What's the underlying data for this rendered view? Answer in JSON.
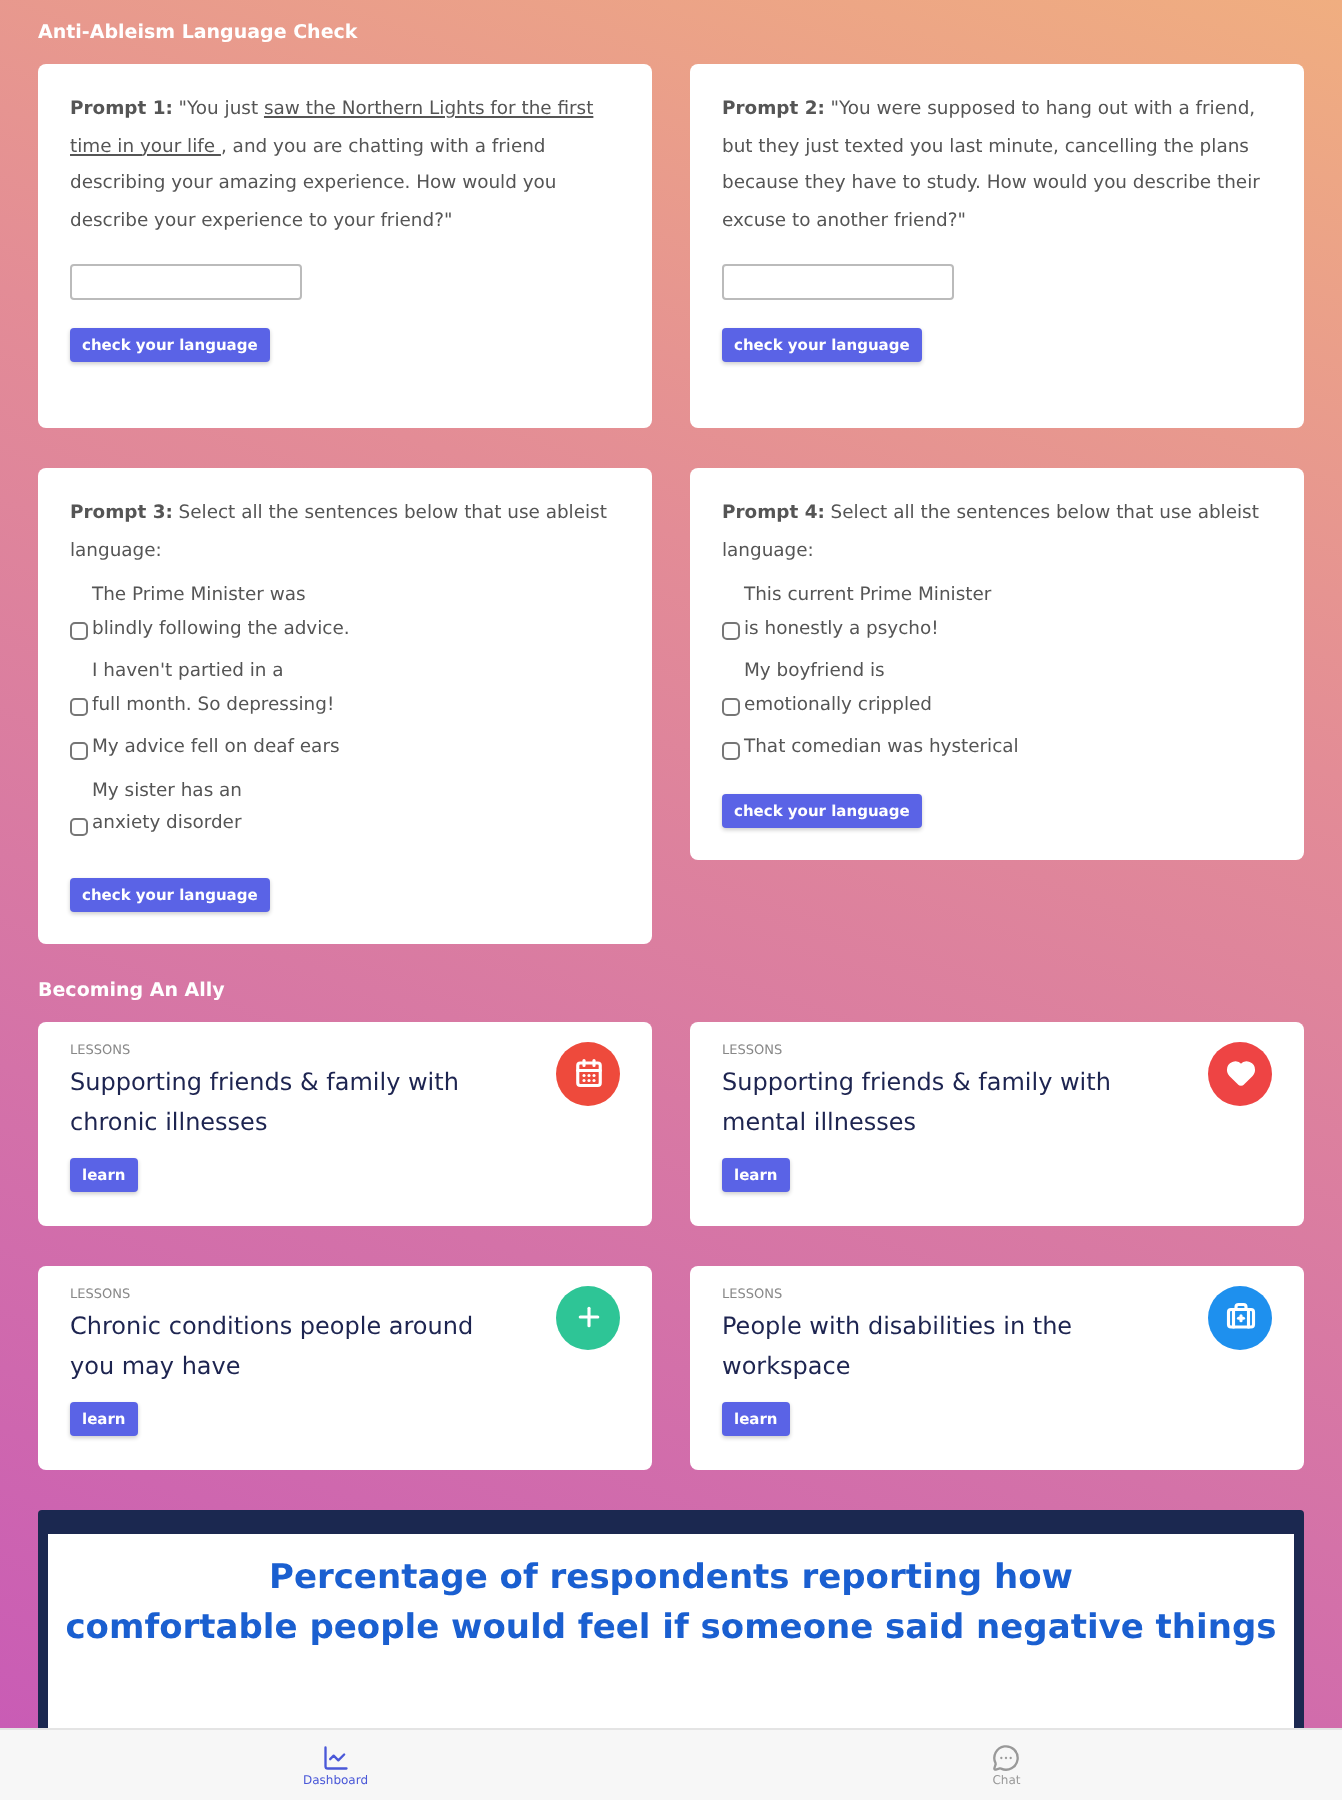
{
  "sections": [
    {
      "title": "Anti-Ableism Language Check"
    }
  ],
  "prompts": [
    {
      "kind": "text",
      "label": "Prompt 1:",
      "parts": [
        {
          "text": " \"You just ",
          "underlined": false
        },
        {
          "text": "saw the Northern Lights for the first time in your life ",
          "underlined": true
        },
        {
          "text": ", and you are chatting with a friend describing your amazing experience. How would you describe your experience to your friend?\"",
          "underlined": false
        }
      ],
      "button": "check your language"
    },
    {
      "kind": "text",
      "label": "Prompt 2:",
      "parts": [
        {
          "text": " \"You were supposed to hang out with a friend, but they just texted you last minute, cancelling the plans because they have to study. How would you describe their excuse to another friend?\"",
          "underlined": false
        }
      ],
      "button": "check your language"
    },
    {
      "kind": "select",
      "label": "Prompt 3:",
      "parts": [
        {
          "text": " Select all the sentences below that use ableist language:",
          "underlined": false
        }
      ],
      "options": [
        {
          "text": "The Prime Minister was\nblindly following the advice.",
          "checked": false
        },
        {
          "text": "I haven't partied in a\nfull month. So depressing!",
          "checked": false
        },
        {
          "text": "My advice fell on deaf ears",
          "checked": false
        },
        {
          "text": "My sister has an\nanxiety disorder",
          "checked": false
        }
      ],
      "button": "check your language"
    },
    {
      "kind": "select",
      "label": "Prompt 4:",
      "parts": [
        {
          "text": " Select all the sentences below that use ableist language:",
          "underlined": false
        }
      ],
      "options": [
        {
          "text": "This current Prime Minister\nis honestly a psycho!",
          "checked": false
        },
        {
          "text": "My boyfriend is\nemotionally crippled",
          "checked": false
        },
        {
          "text": "That comedian was hysterical",
          "checked": false
        }
      ],
      "button": "check your language"
    }
  ],
  "ally": {
    "title": "Becoming An Ally",
    "lessons": [
      {
        "category": "LESSONS",
        "title": "Supporting friends & family with chronic illnesses",
        "button": "learn",
        "kind": "calendar",
        "color": "#ee4a3c"
      },
      {
        "category": "LESSONS",
        "title": "Supporting friends & family with mental illnesses",
        "button": "learn",
        "kind": "heart",
        "color": "#ee4444"
      },
      {
        "category": "LESSONS",
        "title": "Chronic conditions people around you may have",
        "button": "learn",
        "kind": "plus",
        "color": "#2ec596"
      },
      {
        "category": "LESSONS",
        "title": "People with disabilities in the workspace",
        "button": "learn",
        "kind": "briefcase",
        "color": "#1e90ee"
      }
    ]
  },
  "infographic": {
    "title": "Percentage of respondents reporting how\ncomfortable people would feel if someone said negative things"
  },
  "tab_bar": [
    {
      "label": "Dashboard",
      "selected": true,
      "kind": "chart"
    },
    {
      "label": "Chat",
      "selected": false,
      "kind": "chat"
    }
  ]
}
